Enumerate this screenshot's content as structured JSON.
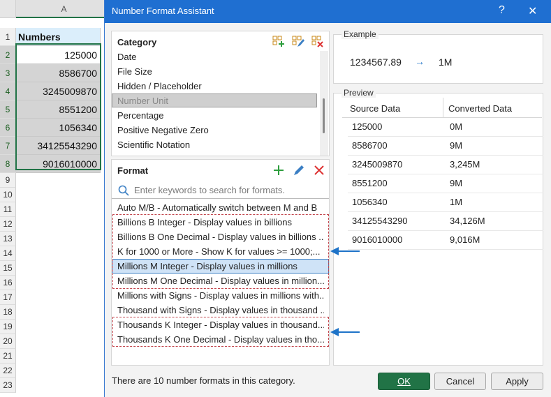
{
  "sheet": {
    "column_label": "A",
    "rows": [
      "1",
      "2",
      "3",
      "4",
      "5",
      "6",
      "7",
      "8",
      "9",
      "10",
      "11",
      "12",
      "13",
      "14",
      "15",
      "16",
      "17",
      "18",
      "19",
      "20",
      "21",
      "22",
      "23"
    ],
    "header_cell": "Numbers",
    "values": [
      "125000",
      "8586700",
      "3245009870",
      "8551200",
      "1056340",
      "34125543290",
      "9016010000"
    ]
  },
  "dialog": {
    "title": "Number Format Assistant",
    "help": "?",
    "close": "✕",
    "category": {
      "header": "Category",
      "items": [
        "Date",
        "File Size",
        "Hidden / Placeholder",
        "Number Unit",
        "Percentage",
        "Positive Negative Zero",
        "Scientific Notation"
      ],
      "selected": "Number Unit"
    },
    "format": {
      "header": "Format",
      "search_placeholder": "Enter keywords to search for formats.",
      "items": [
        "Auto M/B - Automatically switch between M and B",
        "Billions B Integer - Display values in billions",
        "Billions B One Decimal - Display values in billions ...",
        "K for 1000 or More - Show K for values >= 1000;...",
        "Millions M Integer - Display values in millions",
        "Millions M One Decimal - Display values in million...",
        "Millions with Signs - Display values in millions with...",
        "Thousand with Signs - Display values in thousand ...",
        "Thousands K Integer - Display values in thousand...",
        "Thousands K One Decimal - Display values in tho..."
      ],
      "selected": "Millions M Integer - Display values in millions"
    },
    "example": {
      "label": "Example",
      "input": "1234567.89",
      "arrow": "→",
      "output": "1M"
    },
    "preview": {
      "label": "Preview",
      "columns": [
        "Source Data",
        "Converted Data"
      ],
      "rows": [
        [
          "125000",
          "0M"
        ],
        [
          "8586700",
          "9M"
        ],
        [
          "3245009870",
          "3,245M"
        ],
        [
          "8551200",
          "9M"
        ],
        [
          "1056340",
          "1M"
        ],
        [
          "34125543290",
          "34,126M"
        ],
        [
          "9016010000",
          "9,016M"
        ]
      ]
    },
    "footer": {
      "status": "There are 10 number formats in this category.",
      "ok": "OK",
      "cancel": "Cancel",
      "apply": "Apply"
    }
  },
  "colors": {
    "title_bar": "#1f6fd1",
    "ok_button": "#217346",
    "selection_highlight": "#cfe3f7",
    "annotation_dash": "#c2464d",
    "annotation_arrow": "#1e73c8"
  }
}
